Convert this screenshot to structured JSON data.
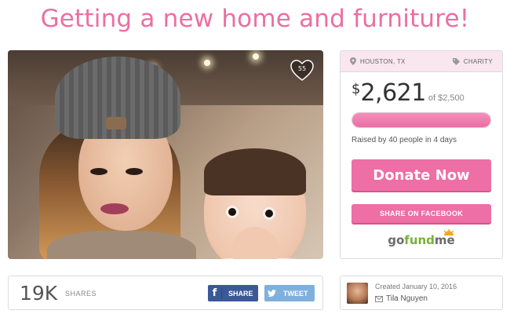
{
  "campaign": {
    "title": "Getting a new home and furniture!",
    "likes": "55"
  },
  "donate_card": {
    "location": "HOUSTON, TX",
    "category": "CHARITY",
    "currency_symbol": "$",
    "raised_amount": "2,621",
    "goal_text": "of $2,500",
    "progress_fraction": 1.0,
    "raised_by": "Raised by 40 people in 4 days",
    "donate_label": "Donate Now",
    "share_facebook_label": "SHARE ON FACEBOOK",
    "logo_go": "go",
    "logo_fund": "fund",
    "logo_me": "me"
  },
  "shares": {
    "count": "19K",
    "label": "SHARES",
    "facebook_icon": "f",
    "facebook_label": "SHARE",
    "twitter_label": "TWEET"
  },
  "creator": {
    "created": "Created January 10, 2016",
    "name": "Tila Nguyen"
  },
  "colors": {
    "accent": "#ec6ea3",
    "facebook": "#3b5998",
    "twitter": "#7fb0dd",
    "logo_green": "#78b03b"
  }
}
